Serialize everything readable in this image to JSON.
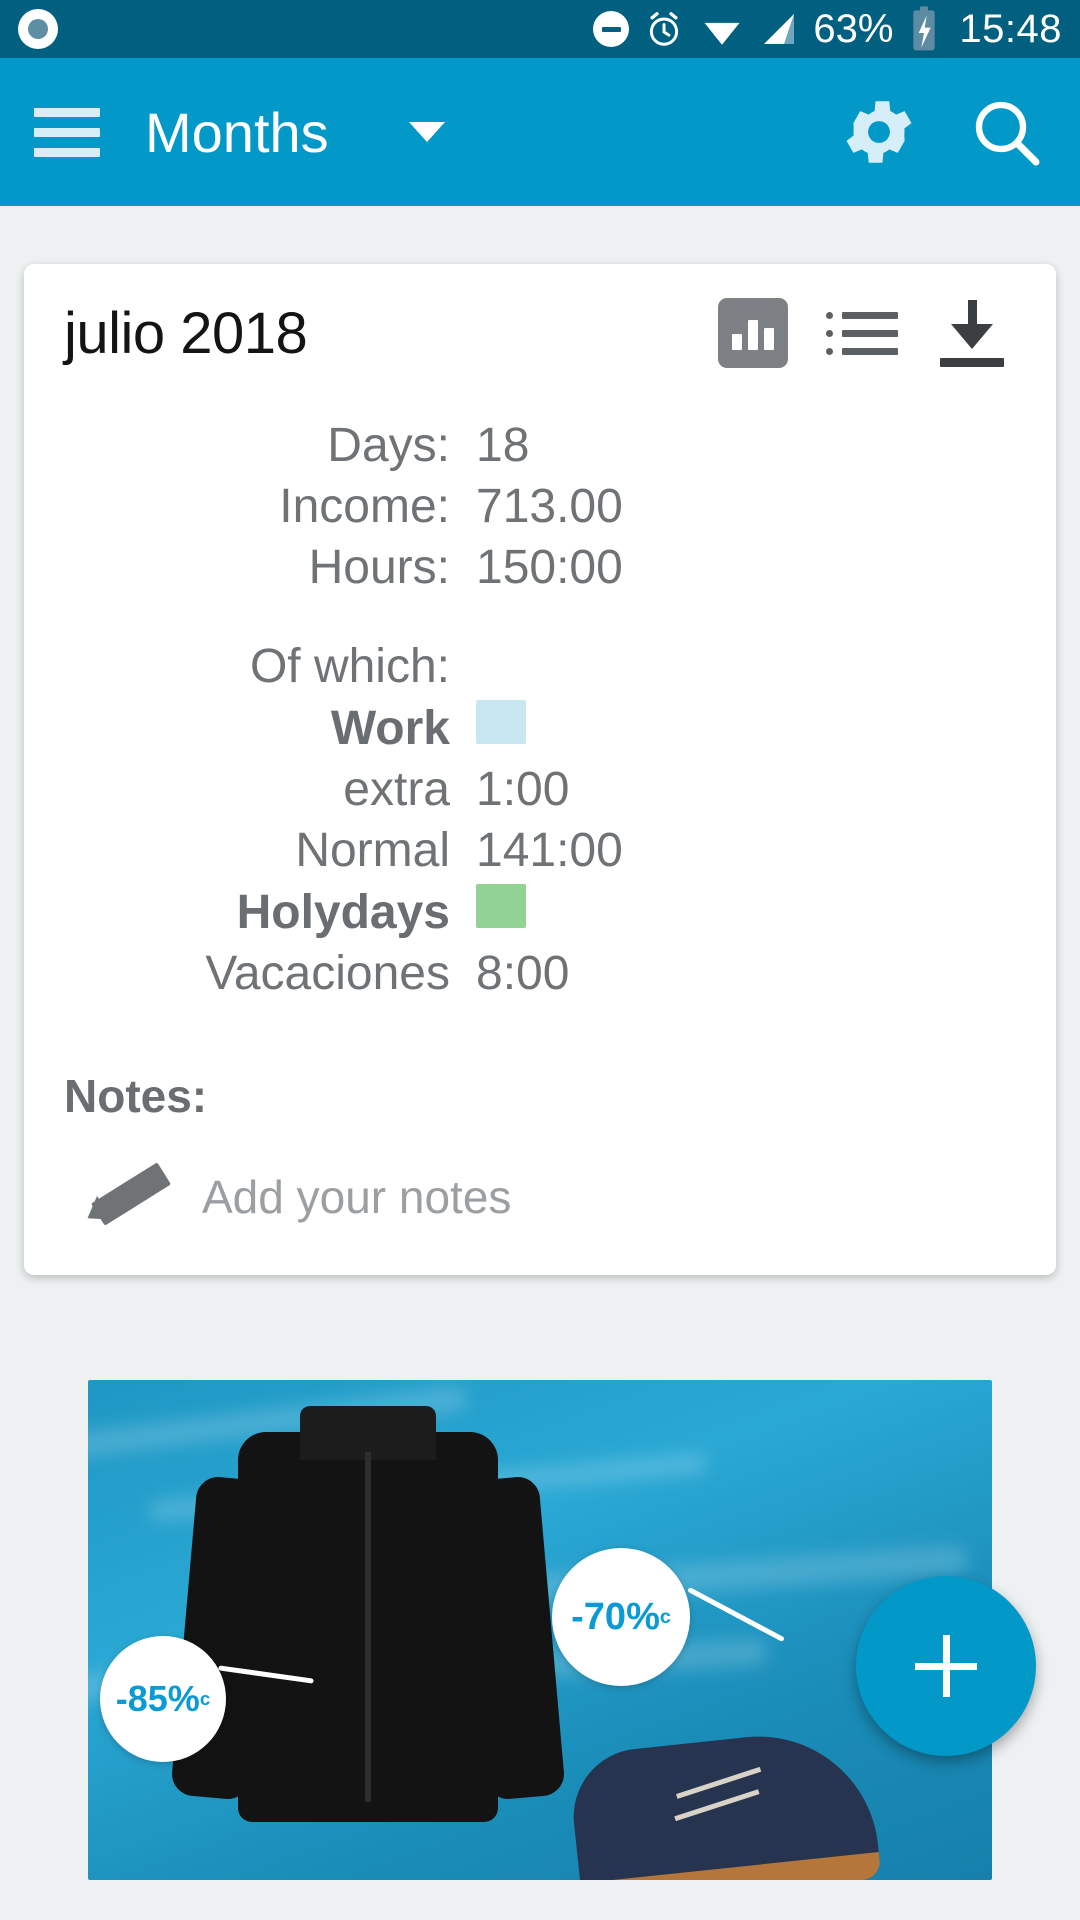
{
  "status_bar": {
    "record_icon": "record-icon",
    "dnd_icon": "do-not-disturb-icon",
    "alarm_icon": "alarm-clock-icon",
    "wifi_icon": "wifi-icon",
    "signal_icon": "cellular-signal-icon",
    "battery_percent": "63%",
    "battery_icon": "battery-charging-icon",
    "time": "15:48"
  },
  "app_bar": {
    "menu_icon": "hamburger-menu-icon",
    "title": "Months",
    "dropdown_icon": "chevron-down-icon",
    "settings_icon": "gear-icon",
    "search_icon": "search-icon"
  },
  "card": {
    "title": "julio 2018",
    "icons": {
      "chart": "bar-chart-icon",
      "list": "list-icon",
      "download": "download-icon"
    },
    "summary": [
      {
        "label": "Days:",
        "value": "18"
      },
      {
        "label": "Income:",
        "value": "713.00"
      },
      {
        "label": "Hours:",
        "value": "150:00"
      }
    ],
    "of_which_label": "Of which:",
    "breakdown": [
      {
        "label": "Work",
        "value": "",
        "bold": true,
        "swatch": "#c9e7f3"
      },
      {
        "label": "extra",
        "value": "1:00",
        "bold": false,
        "swatch": ""
      },
      {
        "label": "Normal",
        "value": "141:00",
        "bold": false,
        "swatch": ""
      },
      {
        "label": "Holydays",
        "value": "",
        "bold": true,
        "swatch": "#92d395"
      },
      {
        "label": "Vacaciones",
        "value": "8:00",
        "bold": false,
        "swatch": ""
      }
    ],
    "notes_title": "Notes:",
    "notes_pencil_icon": "pencil-icon",
    "notes_placeholder": "Add your notes"
  },
  "ad": {
    "badge_left": "-85%",
    "badge_left_sup": "c",
    "badge_right": "-70%",
    "badge_right_sup": "c"
  },
  "fab": {
    "icon": "plus-icon"
  },
  "colors": {
    "status_bar": "#016080",
    "app_bar": "#0299c9",
    "accent": "#0299c9",
    "work_swatch": "#c9e7f3",
    "holiday_swatch": "#92d395",
    "text_muted": "#6f7376"
  }
}
